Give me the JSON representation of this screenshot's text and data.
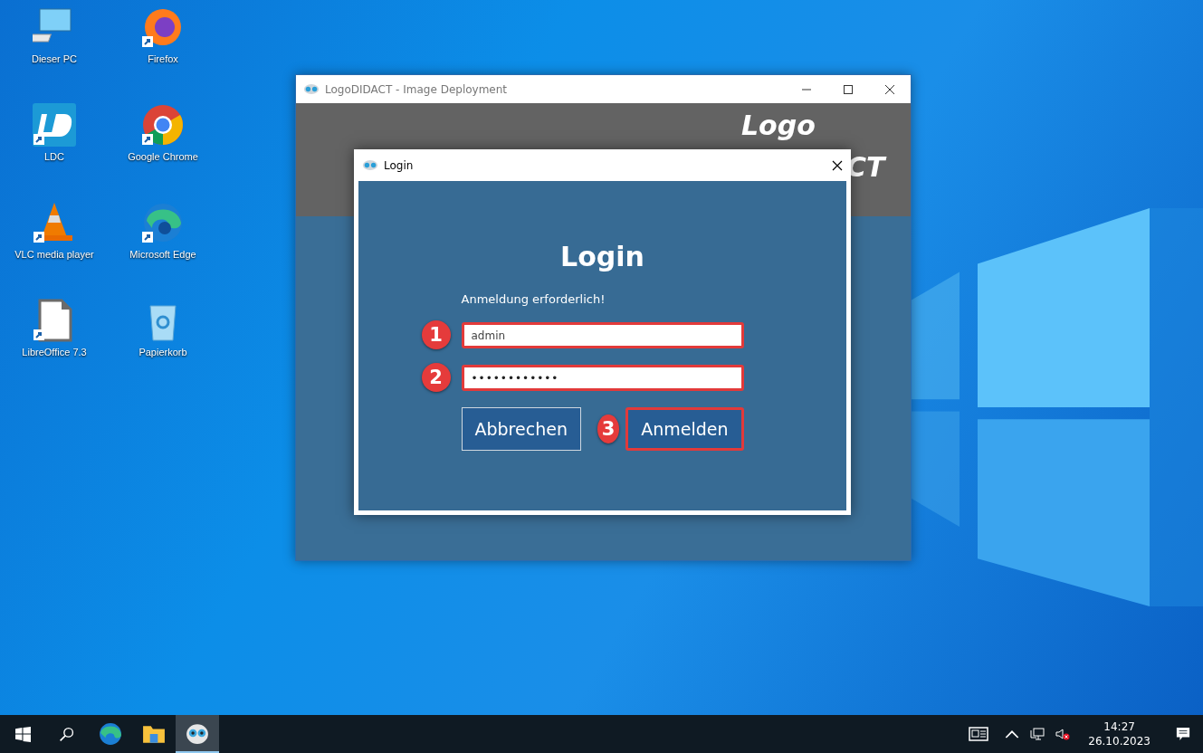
{
  "desktop_icons": [
    {
      "kind": "pc",
      "label": "Dieser PC",
      "shortcut": false
    },
    {
      "kind": "firefox",
      "label": "Firefox",
      "shortcut": true
    },
    {
      "kind": "ldc",
      "label": "LDC",
      "shortcut": true
    },
    {
      "kind": "chrome",
      "label": "Google Chrome",
      "shortcut": true
    },
    {
      "kind": "vlc",
      "label": "VLC media player",
      "shortcut": true
    },
    {
      "kind": "edge",
      "label": "Microsoft Edge",
      "shortcut": true
    },
    {
      "kind": "libreoffice",
      "label": "LibreOffice 7.3",
      "shortcut": true
    },
    {
      "kind": "recycle",
      "label": "Papierkorb",
      "shortcut": false
    }
  ],
  "window": {
    "title": "LogoDIDACT - Image Deployment",
    "banner_logo": [
      "Logo",
      "CT"
    ]
  },
  "dialog": {
    "title": "Login",
    "heading": "Login",
    "message": "Anmeldung erforderlich!",
    "fields": [
      {
        "kind": "text",
        "value": "admin",
        "marker": "1",
        "highlighted": true
      },
      {
        "kind": "password",
        "value": "••••••••••••",
        "marker": "2",
        "highlighted": true
      }
    ],
    "buttons": [
      {
        "label": "Abbrechen",
        "highlighted": false
      },
      {
        "label": "Anmelden",
        "marker": "3",
        "highlighted": true
      }
    ]
  },
  "taskbar": {
    "apps": [
      {
        "kind": "edge",
        "selected": false
      },
      {
        "kind": "explorer",
        "selected": false
      },
      {
        "kind": "owl",
        "selected": true
      }
    ],
    "time": "14:27",
    "date": "26.10.2023"
  }
}
